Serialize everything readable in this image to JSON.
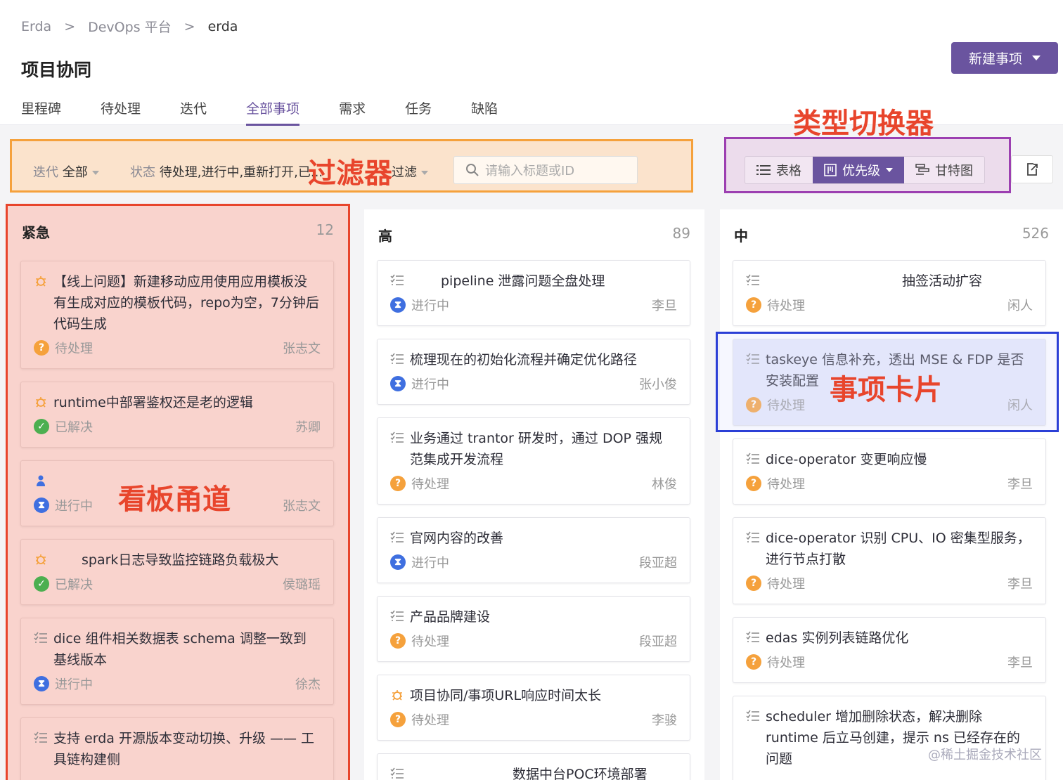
{
  "breadcrumb": [
    "Erda",
    "DevOps 平台",
    "erda"
  ],
  "breadcrumb_sep": ">",
  "page_title": "项目协同",
  "new_button": "新建事项",
  "tabs": [
    "里程碑",
    "待处理",
    "迭代",
    "全部事项",
    "需求",
    "任务",
    "缺陷"
  ],
  "active_tab": "全部事项",
  "filter": {
    "iteration_label": "迭代",
    "iteration_value": "全部",
    "status_label": "状态",
    "status_value": "待处理,进行中,重新打开,已...",
    "more_label": "过滤",
    "search_placeholder": "请输入标题或ID"
  },
  "view_switch": {
    "table": "表格",
    "priority": "优先级",
    "gantt": "甘特图"
  },
  "annotations": {
    "filter": "过滤器",
    "switcher": "类型切换器",
    "lane": "看板甬道",
    "card": "事项卡片"
  },
  "lanes": [
    {
      "title": "紧急",
      "count": "12",
      "cards": [
        {
          "type": "bug",
          "title": "【线上问题】新建移动应用使用应用模板没有生成对应的模板代码，repo为空，7分钟后代码生成",
          "status": "待处理",
          "status_kind": "todo",
          "assignee": "张志文"
        },
        {
          "type": "bug",
          "title": "runtime中部署鉴权还是老的逻辑",
          "status": "已解决",
          "status_kind": "done",
          "assignee": "苏卿"
        },
        {
          "type": "requirement",
          "title": "",
          "status": "进行中",
          "status_kind": "doing",
          "assignee": "张志文"
        },
        {
          "type": "bug",
          "title": "spark日志导致监控链路负载极大",
          "status": "已解决",
          "status_kind": "done",
          "assignee": "侯璐瑶"
        },
        {
          "type": "task",
          "title": "dice 组件相关数据表 schema 调整一致到基线版本",
          "status": "进行中",
          "status_kind": "doing",
          "assignee": "徐杰"
        },
        {
          "type": "task",
          "title": "支持 erda 开源版本变动切换、升级 —— 工具链构建侧",
          "status": "",
          "status_kind": "doing",
          "assignee": ""
        }
      ]
    },
    {
      "title": "高",
      "count": "89",
      "cards": [
        {
          "type": "task",
          "title": "pipeline 泄露问题全盘处理",
          "status": "进行中",
          "status_kind": "doing",
          "assignee": "李旦"
        },
        {
          "type": "task",
          "title": "梳理现在的初始化流程并确定优化路径",
          "status": "进行中",
          "status_kind": "doing",
          "assignee": "张小俊"
        },
        {
          "type": "task",
          "title": "业务通过 trantor 研发时，通过 DOP 强规范集成开发流程",
          "status": "待处理",
          "status_kind": "todo",
          "assignee": "林俊"
        },
        {
          "type": "task",
          "title": "官网内容的改善",
          "status": "进行中",
          "status_kind": "doing",
          "assignee": "段亚超"
        },
        {
          "type": "task",
          "title": "产品品牌建设",
          "status": "待处理",
          "status_kind": "todo",
          "assignee": "段亚超"
        },
        {
          "type": "bug",
          "title": "项目协同/事项URL响应时间太长",
          "status": "待处理",
          "status_kind": "todo",
          "assignee": "李骏"
        },
        {
          "type": "task",
          "title": "数据中台POC环境部署",
          "status": "",
          "status_kind": "todo",
          "assignee": ""
        }
      ]
    },
    {
      "title": "中",
      "count": "526",
      "cards": [
        {
          "type": "task",
          "title": "抽签活动扩容",
          "status": "待处理",
          "status_kind": "todo",
          "assignee": "闲人"
        },
        {
          "type": "task",
          "title": "taskeye 信息补充，透出 MSE & FDP 是否安装配置",
          "status": "待处理",
          "status_kind": "todo",
          "assignee": "闲人"
        },
        {
          "type": "task",
          "title": "dice-operator 变更响应慢",
          "status": "待处理",
          "status_kind": "todo",
          "assignee": "李旦"
        },
        {
          "type": "task",
          "title": "dice-operator 识别 CPU、IO 密集型服务，进行节点打散",
          "status": "待处理",
          "status_kind": "todo",
          "assignee": "李旦"
        },
        {
          "type": "task",
          "title": "edas 实例列表链路优化",
          "status": "待处理",
          "status_kind": "todo",
          "assignee": "李旦"
        },
        {
          "type": "task",
          "title": "scheduler 增加删除状态，解决删除 runtime 后立马创建，提示 ns 已经存在的问题",
          "status": "",
          "status_kind": "todo",
          "assignee": ""
        }
      ]
    }
  ],
  "watermark": "@稀土掘金技术社区",
  "colors": {
    "accent": "#6a549f",
    "todo": "#f5a13c",
    "doing": "#3f6fe0",
    "done": "#4caf50",
    "annotation": "#e8452c"
  }
}
